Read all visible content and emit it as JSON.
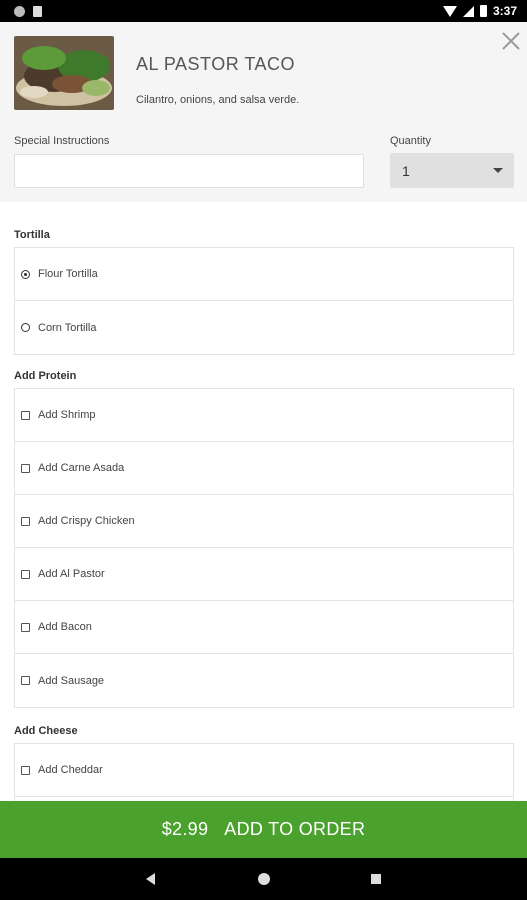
{
  "status_bar": {
    "time": "3:37"
  },
  "item": {
    "title": "AL PASTOR TACO",
    "description": "Cilantro, onions, and salsa verde."
  },
  "form": {
    "special_label": "Special Instructions",
    "special_value": "",
    "quantity_label": "Quantity",
    "quantity_value": "1"
  },
  "sections": {
    "tortilla": {
      "label": "Tortilla",
      "options": [
        {
          "label": "Flour Tortilla",
          "selected": true
        },
        {
          "label": "Corn Tortilla",
          "selected": false
        }
      ]
    },
    "protein": {
      "label": "Add Protein",
      "options": [
        {
          "label": "Add Shrimp"
        },
        {
          "label": "Add Carne Asada"
        },
        {
          "label": "Add Crispy Chicken"
        },
        {
          "label": "Add Al Pastor"
        },
        {
          "label": "Add Bacon"
        },
        {
          "label": "Add Sausage"
        }
      ]
    },
    "cheese": {
      "label": "Add Cheese",
      "options": [
        {
          "label": "Add Cheddar"
        }
      ]
    }
  },
  "order_button": {
    "price": "$2.99",
    "label": "ADD TO ORDER",
    "color": "#4aa12d"
  },
  "icons": [
    "close-icon",
    "chevron-down-icon",
    "radio-icon",
    "checkbox-icon",
    "back-icon",
    "home-icon",
    "recents-icon"
  ]
}
